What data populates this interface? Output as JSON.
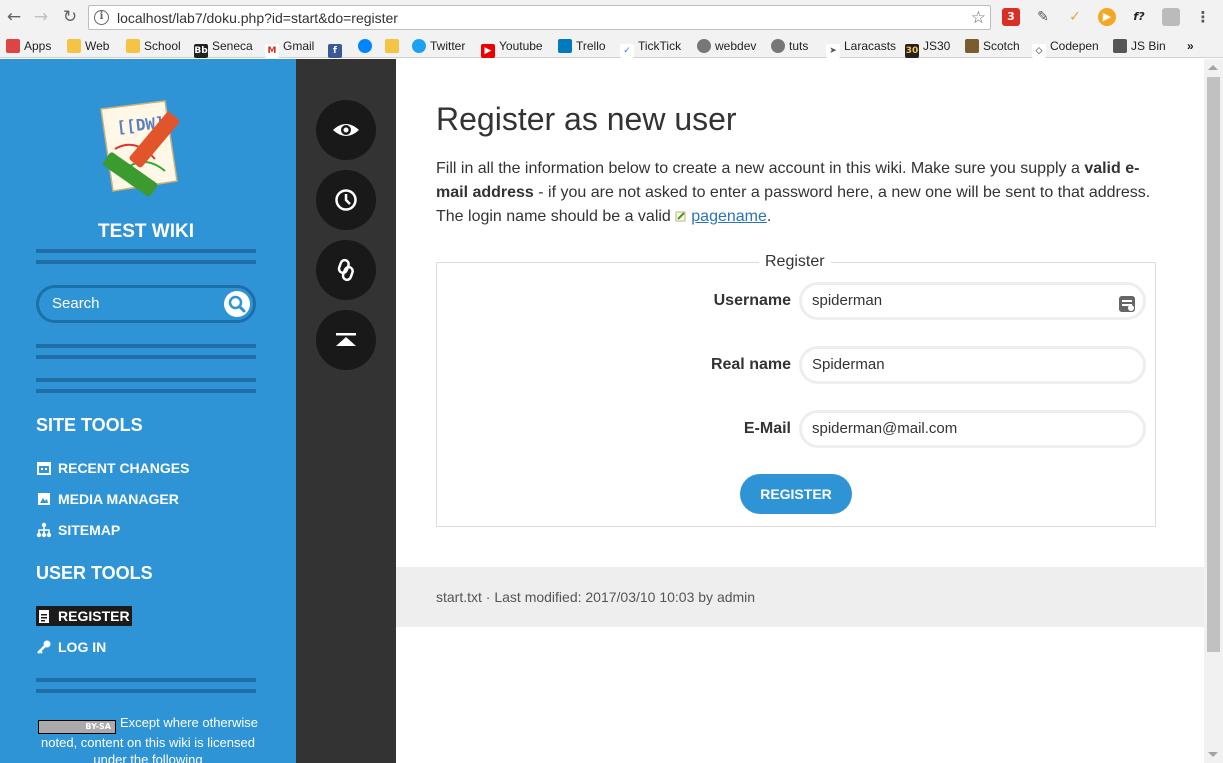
{
  "browser": {
    "url": "localhost/lab7/doku.php?id=start&do=register",
    "bookmarks": [
      "Apps",
      "Web",
      "School",
      "Seneca",
      "Gmail",
      "Twitter",
      "Youtube",
      "Trello",
      "TickTick",
      "webdev",
      "tuts",
      "Laracasts",
      "JS30",
      "Scotch",
      "Codepen",
      "JS Bin"
    ],
    "bookmark_icons": {
      "seneca": "Bb",
      "gmail": "M",
      "js30": "30"
    },
    "extensions": {
      "mail_badge": "3",
      "f_label": "f?"
    },
    "more_bookmarks": "»"
  },
  "sidebar": {
    "logo_text": "[[DW]]",
    "wiki_title": "TEST WIKI",
    "search_placeholder": "Search",
    "site_tools_heading": "SITE TOOLS",
    "site_tools": [
      "RECENT CHANGES",
      "MEDIA MANAGER",
      "SITEMAP"
    ],
    "user_tools_heading": "USER TOOLS",
    "user_tools": [
      "REGISTER",
      "LOG IN"
    ],
    "license_badge": "BY-SA",
    "license_text": "Except where otherwise noted, content on this wiki is licensed under the following"
  },
  "main": {
    "title": "Register as new user",
    "intro_1": "Fill in all the information below to create a new account in this wiki. Make sure you supply a ",
    "intro_bold": "valid e-mail address",
    "intro_2": " - if you are not asked to enter a password here, a new one will be sent to that address. The login name should be a valid ",
    "intro_link": "pagename",
    "intro_end": ".",
    "form": {
      "legend": "Register",
      "username_label": "Username",
      "username_value": "spiderman",
      "realname_label": "Real name",
      "realname_value": "Spiderman",
      "email_label": "E-Mail",
      "email_value": "spiderman@mail.com",
      "submit_label": "REGISTER"
    },
    "footer": "start.txt · Last modified: 2017/03/10 10:03 by admin"
  },
  "colors": {
    "sidebar": "#2f94d6",
    "sidebar_dark": "#1e6fa8",
    "pagetools": "#333333",
    "button": "#2f94d6"
  }
}
